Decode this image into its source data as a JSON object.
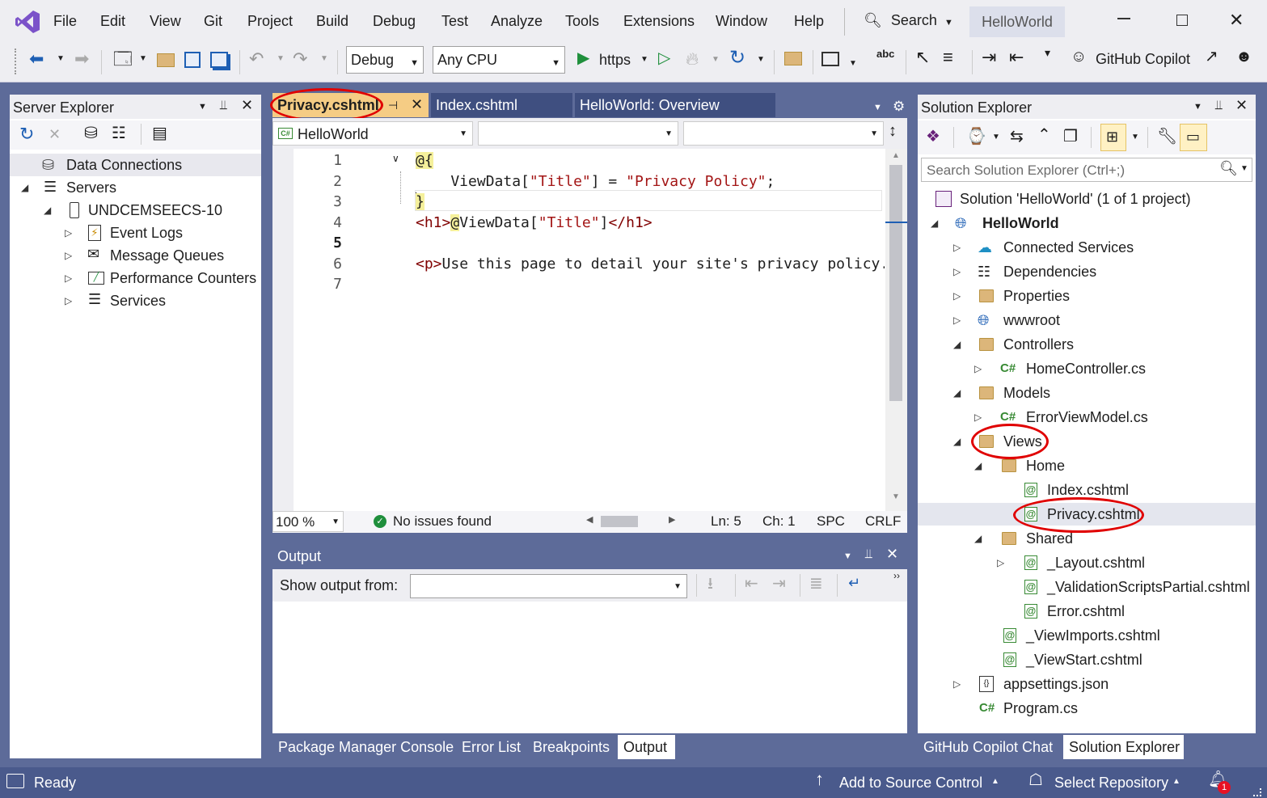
{
  "menu": [
    "File",
    "Edit",
    "View",
    "Git",
    "Project",
    "Build",
    "Debug",
    "Test",
    "Analyze",
    "Tools",
    "Extensions",
    "Window",
    "Help"
  ],
  "search_label": "Search",
  "solution_name": "HelloWorld",
  "toolbar": {
    "config": "Debug",
    "platform": "Any CPU",
    "run_target": "https",
    "copilot": "GitHub Copilot"
  },
  "server_explorer": {
    "title": "Server Explorer",
    "items": [
      {
        "label": "Data Connections",
        "icon": "database-icon"
      },
      {
        "label": "Servers",
        "icon": "servers-icon"
      },
      {
        "label": "UNDCEMSEECS-10",
        "icon": "computer-icon"
      },
      {
        "label": "Event Logs",
        "icon": "event-log-icon"
      },
      {
        "label": "Message Queues",
        "icon": "message-queue-icon"
      },
      {
        "label": "Performance Counters",
        "icon": "performance-icon"
      },
      {
        "label": "Services",
        "icon": "services-icon"
      }
    ]
  },
  "editor": {
    "tabs": [
      {
        "label": "Privacy.cshtml",
        "active": true
      },
      {
        "label": "Index.cshtml",
        "active": false
      },
      {
        "label": "HelloWorld: Overview",
        "active": false
      }
    ],
    "nav_project": "HelloWorld",
    "line_numbers": [
      "1",
      "2",
      "3",
      "4",
      "5",
      "6",
      "7"
    ],
    "zoom": "100 %",
    "issues": "No issues found",
    "line": "Ln: 5",
    "col": "Ch: 1",
    "spc": "SPC",
    "eol": "CRLF"
  },
  "output": {
    "title": "Output",
    "show_from_label": "Show output from:"
  },
  "bottom_tabs": [
    "Package Manager Console",
    "Error List",
    "Breakpoints",
    "Output"
  ],
  "solution_explorer": {
    "title": "Solution Explorer",
    "search_placeholder": "Search Solution Explorer (Ctrl+;)",
    "items": [
      {
        "label": "Solution 'HelloWorld' (1 of 1 project)"
      },
      {
        "label": "HelloWorld"
      },
      {
        "label": "Connected Services"
      },
      {
        "label": "Dependencies"
      },
      {
        "label": "Properties"
      },
      {
        "label": "wwwroot"
      },
      {
        "label": "Controllers"
      },
      {
        "label": "HomeController.cs"
      },
      {
        "label": "Models"
      },
      {
        "label": "ErrorViewModel.cs"
      },
      {
        "label": "Views"
      },
      {
        "label": "Home"
      },
      {
        "label": "Index.cshtml"
      },
      {
        "label": "Privacy.cshtml"
      },
      {
        "label": "Shared"
      },
      {
        "label": "_Layout.cshtml"
      },
      {
        "label": "_ValidationScriptsPartial.cshtml"
      },
      {
        "label": "Error.cshtml"
      },
      {
        "label": "_ViewImports.cshtml"
      },
      {
        "label": "_ViewStart.cshtml"
      },
      {
        "label": "appsettings.json"
      },
      {
        "label": "Program.cs"
      }
    ],
    "bottom_tabs": [
      "GitHub Copilot Chat",
      "Solution Explorer"
    ]
  },
  "status": {
    "ready": "Ready",
    "source_control": "Add to Source Control",
    "repository": "Select Repository",
    "notifications": "1"
  },
  "colors": {
    "accent": "#5d6b99",
    "status": "#4a5a8c",
    "highlight": "#e00000",
    "vs_purple": "#68217a"
  }
}
